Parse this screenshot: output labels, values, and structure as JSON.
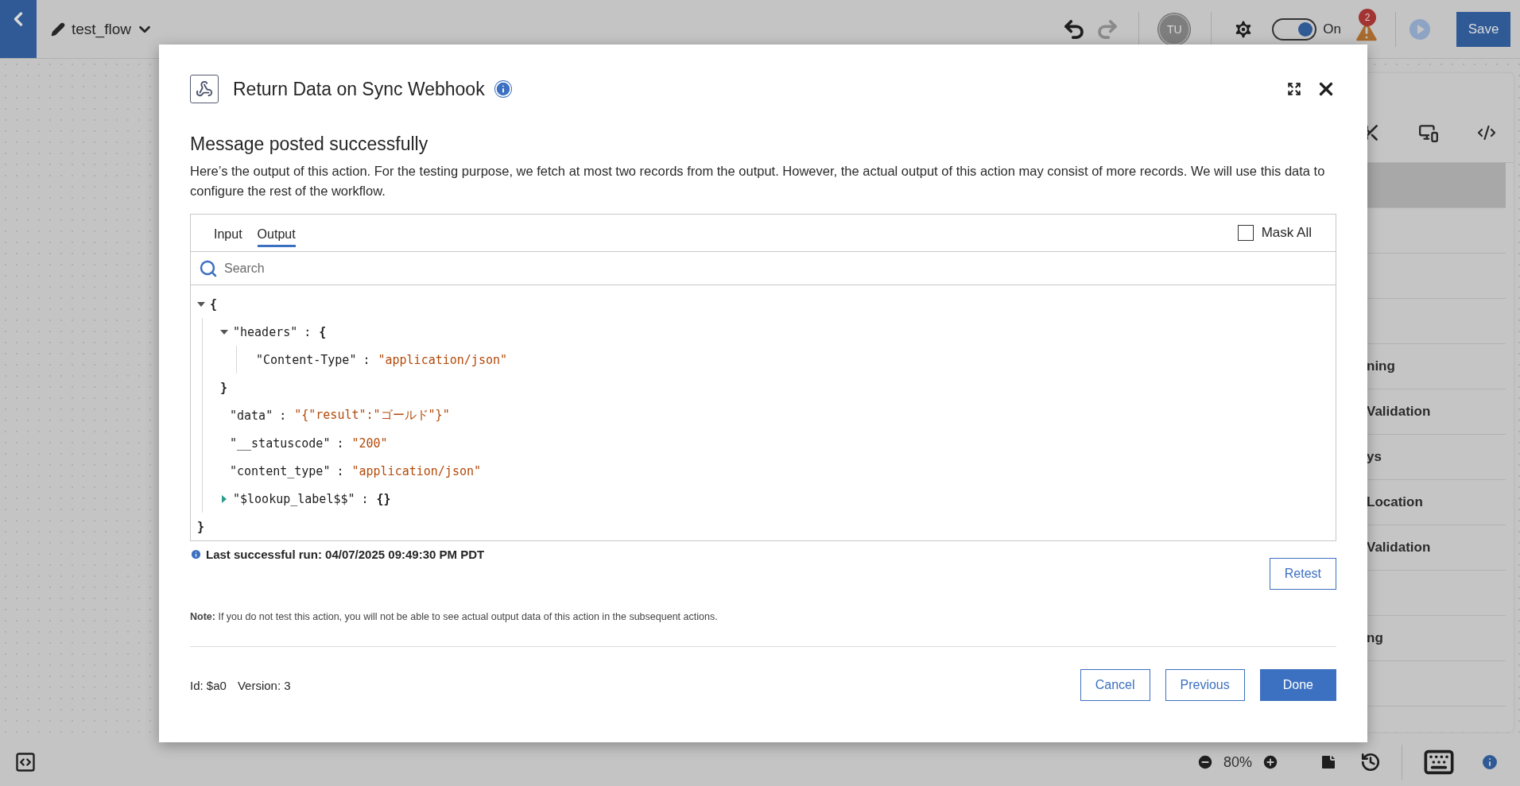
{
  "top_bar": {
    "flow_name": "test_flow",
    "avatar": "TU",
    "toggle": {
      "on": true,
      "label": "On"
    },
    "alert_count": "2",
    "save_label": "Save"
  },
  "side_panel": {
    "items": [
      {
        "selected": true
      },
      {
        "selected": false
      },
      {
        "selected": false
      },
      {
        "selected": false
      },
      {
        "label": "ning",
        "selected": false
      },
      {
        "label": "Validation",
        "selected": false
      },
      {
        "label": "ys",
        "selected": false
      },
      {
        "label": "Location",
        "selected": false
      },
      {
        "label": "Validation",
        "selected": false
      },
      {
        "selected": false
      },
      {
        "label": "ng",
        "selected": false
      },
      {
        "selected": false
      }
    ]
  },
  "bottom_bar": {
    "zoom": "80%"
  },
  "dialog": {
    "title": "Return Data on Sync Webhook",
    "heading": "Message posted successfully",
    "description": "Here’s the output of this action. For the testing purpose, we fetch at most two records from the output. However, the actual output of this action may consist of more records. We will use this data to configure the rest of the workflow.",
    "tabs": [
      {
        "label": "Input",
        "selected": false
      },
      {
        "label": "Output",
        "selected": true
      }
    ],
    "mask_all": {
      "label": "Mask All",
      "checked": false
    },
    "search": {
      "placeholder": "Search"
    },
    "tree": {
      "colon": ":",
      "root": {
        "kind": "object",
        "expanded": true,
        "open": "{",
        "close": "}",
        "children": [
          {
            "kind": "object",
            "key": "\"headers\"",
            "expanded": true,
            "open": "{",
            "close": "}",
            "children": [
              {
                "kind": "value",
                "key": "\"Content-Type\"",
                "value": "\"application/json\""
              }
            ]
          },
          {
            "kind": "value",
            "key": "\"data\"",
            "value": "\"{\"result\":\"ゴールド\"}\""
          },
          {
            "kind": "value",
            "key": "\"__statuscode\"",
            "value": "\"200\""
          },
          {
            "kind": "value",
            "key": "\"content_type\"",
            "value": "\"application/json\""
          },
          {
            "kind": "object",
            "key": "\"$lookup_label$$\"",
            "expanded": false,
            "open": "{",
            "close": "}"
          }
        ]
      }
    },
    "last_run": "Last successful run: 04/07/2025 09:49:30 PM PDT",
    "retest_label": "Retest",
    "note": "**Note:** If you do not test this action, you will not be able to see actual output data of this action in the subsequent actions.",
    "id_text": "Id: $a0",
    "version_text": "Version: 3",
    "buttons": [
      {
        "label": "Cancel",
        "kind": "secondary"
      },
      {
        "label": "Previous",
        "kind": "secondary"
      },
      {
        "label": "Done",
        "kind": "primary"
      }
    ]
  }
}
